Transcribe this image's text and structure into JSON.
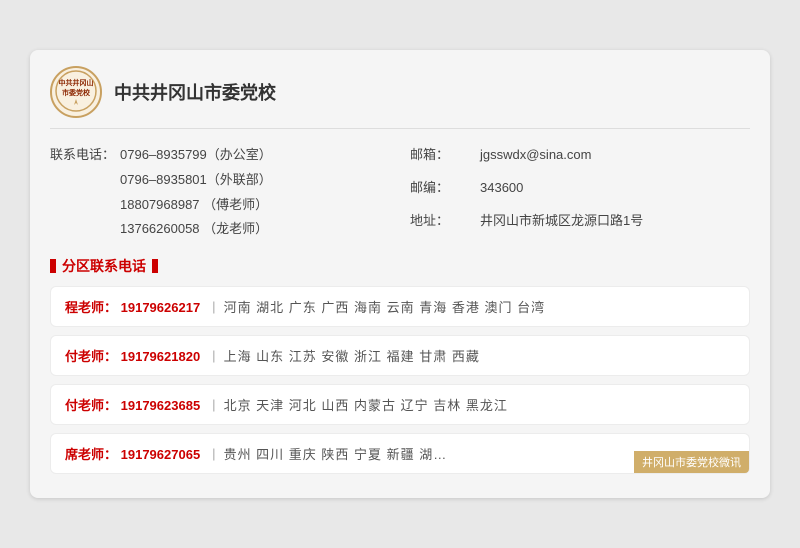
{
  "header": {
    "logo_text": "中共井冈山\n市委党校",
    "school_name": "中共井冈山市委党校"
  },
  "contact": {
    "left": [
      {
        "label": "联系电话：",
        "value": "0796–8935799（办公室）"
      },
      {
        "label": "",
        "value": "0796–8935801（外联部）"
      },
      {
        "label": "",
        "value": "18807968987 （傅老师）"
      },
      {
        "label": "",
        "value": "13766260058 （龙老师）"
      }
    ],
    "right": [
      {
        "label": "邮箱：",
        "value": "jgsswdx@sina.com"
      },
      {
        "label": "",
        "value": ""
      },
      {
        "label": "邮编：",
        "value": "343600"
      },
      {
        "label": "",
        "value": ""
      },
      {
        "label": "地址：",
        "value": "井冈山市新城区龙源口路1号"
      }
    ]
  },
  "section_title": "分区联系电话",
  "regions": [
    {
      "teacher": "程老师：",
      "phone": "19179626217",
      "areas": "河南  湖北  广东  广西  海南  云南  青海  香港  澳门  台湾"
    },
    {
      "teacher": "付老师：",
      "phone": "19179621820",
      "areas": "上海  山东  江苏  安徽  浙江  福建  甘肃  西藏"
    },
    {
      "teacher": "付老师：",
      "phone": "19179623685",
      "areas": "北京  天津  河北  山西  内蒙古  辽宁  吉林  黑龙江"
    },
    {
      "teacher": "席老师：",
      "phone": "19179627065",
      "areas": "贵州  四川  重庆  陕西  宁夏  新疆  湖…"
    }
  ],
  "watermark": "井冈山市委党校微讯"
}
